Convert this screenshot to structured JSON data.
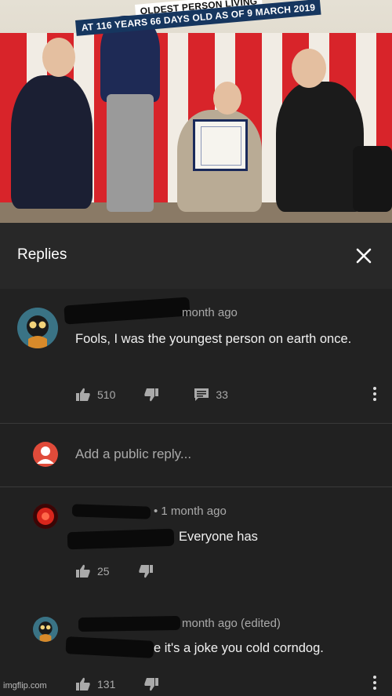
{
  "video": {
    "caption_top": "OLDEST PERSON LIVING",
    "caption_bottom": "AT 116 YEARS 66 DAYS OLD AS OF 9 MARCH 2019"
  },
  "header": {
    "title": "Replies",
    "close_icon": "close-icon"
  },
  "main_comment": {
    "time": "month ago",
    "text": "Fools, I was the youngest person on earth once.",
    "likes": "510",
    "replies": "33",
    "icons": [
      "thumbs-up-icon",
      "thumbs-down-icon",
      "reply-icon",
      "more-vert-icon"
    ]
  },
  "add_reply": {
    "placeholder": "Add a public reply..."
  },
  "replies": [
    {
      "time": "• 1 month ago",
      "text": "Everyone has",
      "likes": "25"
    },
    {
      "time": "month ago (edited)",
      "text": "e it's a joke you cold corndog.",
      "likes": "131"
    }
  ],
  "watermark": "imgflip.com",
  "colors": {
    "background": "#212121",
    "header_bg": "#282828",
    "secondary_text": "#aaaaaa",
    "reply_avatar_red": "#e0281e"
  }
}
